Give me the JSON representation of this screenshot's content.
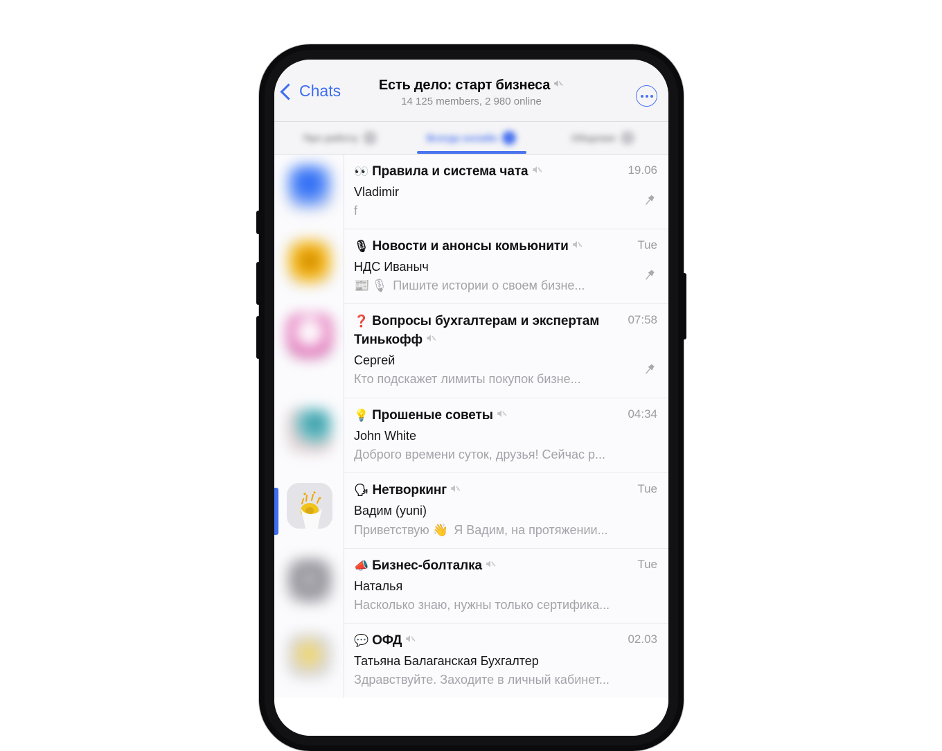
{
  "nav": {
    "back_label": "Chats",
    "title": "Есть дело: старт бизнеса",
    "title_mute_icon": "muted-speaker-icon",
    "subtitle": "14 125 members, 2 980 online",
    "more_icon": "more-ellipsis-icon"
  },
  "tabs": [
    {
      "label": "Про работу",
      "active": false,
      "badge": true
    },
    {
      "label": "Всегда онлайн",
      "active": true,
      "badge": true
    },
    {
      "label": "Общение",
      "active": false,
      "badge": true
    }
  ],
  "colors": {
    "accent_blue": "#3e6ef0",
    "tab_blue": "#4a74f0",
    "screen_bg": "#f5f5f7",
    "list_bg": "#fbfbfd",
    "muted_text": "#a3a3aa",
    "timestamp_text": "#9b9ba2"
  },
  "chats": [
    {
      "emoji": "👀",
      "title": "Правила и система чата",
      "muted": true,
      "timestamp": "19.06",
      "sender": "Vladimir",
      "preview": "f",
      "preview_emojis": [],
      "pinned": true,
      "selected": false,
      "avatar_colors": [
        "#1f5ef5",
        "#7ba0f7",
        "#d8d8dc"
      ],
      "avatar_blurred": true
    },
    {
      "emoji": "🎙",
      "title": "Новости и анонсы комьюнити",
      "muted": true,
      "timestamp": "Tue",
      "sender": "НДС Иваныч",
      "preview": "Пишите истории о своем бизне...",
      "preview_emojis": [
        "📰",
        "🎙"
      ],
      "pinned": true,
      "selected": false,
      "avatar_colors": [
        "#f0a500",
        "#f8c94a",
        "#d9d9dd"
      ],
      "avatar_blurred": true
    },
    {
      "emoji": "❓",
      "title": "Вопросы бухгалтерам и экспертам Тинькофф",
      "muted": true,
      "timestamp": "07:58",
      "sender": "Сергей",
      "preview": "Кто подскажет лимиты покупок бизне...",
      "preview_emojis": [],
      "pinned": true,
      "selected": false,
      "avatar_colors": [
        "#e05fb0",
        "#f6f6f8",
        "#d5d5da"
      ],
      "avatar_blurred": true
    },
    {
      "emoji": "💡",
      "title": "Прошеные советы",
      "muted": true,
      "timestamp": "04:34",
      "sender": "John White",
      "preview": "Доброго времени суток, друзья! Сейчас р...",
      "preview_emojis": [],
      "pinned": false,
      "selected": false,
      "avatar_colors": [
        "#2a8f9e",
        "#e8b2b2",
        "#dcdce0"
      ],
      "avatar_blurred": true
    },
    {
      "emoji": "🗣",
      "title": "Нетворкинг",
      "muted": true,
      "timestamp": "Tue",
      "sender": "Вадим (yuni)",
      "preview": "Я Вадим, на протяжении...",
      "preview_prefix": "Приветствую",
      "preview_emojis": [
        "👋"
      ],
      "pinned": false,
      "selected": true,
      "avatar_colors": [
        "#e2e2e6",
        "#f0c419",
        "#ffffff"
      ],
      "avatar_blurred": false
    },
    {
      "emoji": "📣",
      "title": "Бизнес-болталка",
      "muted": true,
      "timestamp": "Tue",
      "sender": "Наталья",
      "preview": "Насколько знаю, нужны только сертифика...",
      "preview_emojis": [],
      "pinned": false,
      "selected": false,
      "avatar_colors": [
        "#8d8d93",
        "#b8b8be",
        "#e6e6ea"
      ],
      "avatar_blurred": true
    },
    {
      "emoji": "💬",
      "title": "ОФД",
      "muted": true,
      "timestamp": "02.03",
      "sender": "Татьяна Балаганская Бухгалтер",
      "preview": "Здравствуйте. Заходите в личный кабинет...",
      "preview_emojis": [],
      "pinned": false,
      "selected": false,
      "avatar_colors": [
        "#efd14a",
        "#d8d8dc",
        "#ececf0"
      ],
      "avatar_blurred": true
    }
  ]
}
